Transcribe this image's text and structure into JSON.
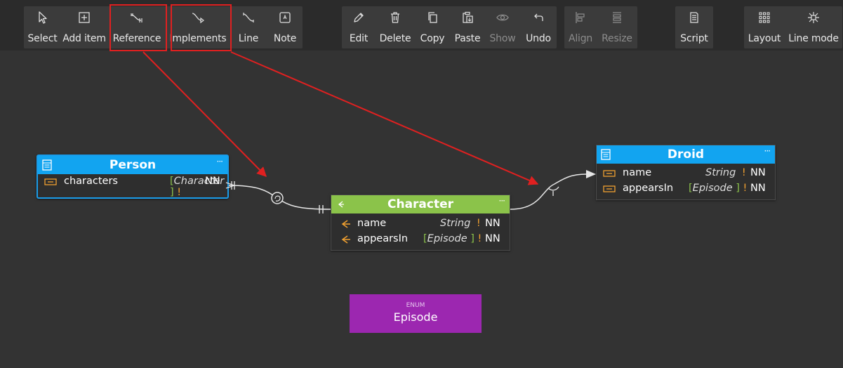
{
  "toolbar": {
    "select": "Select",
    "add_item": "Add item",
    "reference": "Reference",
    "implements": "Implements",
    "line": "Line",
    "note": "Note",
    "edit": "Edit",
    "delete": "Delete",
    "copy": "Copy",
    "paste": "Paste",
    "show": "Show",
    "undo": "Undo",
    "align": "Align",
    "resize": "Resize",
    "script": "Script",
    "layout": "Layout",
    "line_mode": "Line mode"
  },
  "entities": {
    "person": {
      "title": "Person",
      "more": "···",
      "fields": [
        {
          "name": "characters",
          "bracket_open": "[",
          "type": "Character",
          "bracket_close": "]",
          "required": "!",
          "nn": "NN"
        }
      ]
    },
    "character": {
      "title": "Character",
      "more": "···",
      "fields": [
        {
          "name": "name",
          "type": "String",
          "required": "!",
          "nn": "NN"
        },
        {
          "name": "appearsIn",
          "bracket_open": "[",
          "type": "Episode",
          "bracket_close": "]",
          "required": "!",
          "nn": "NN"
        }
      ]
    },
    "droid": {
      "title": "Droid",
      "more": "···",
      "fields": [
        {
          "name": "name",
          "type": "String",
          "required": "!",
          "nn": "NN"
        },
        {
          "name": "appearsIn",
          "bracket_open": "[",
          "type": "Episode",
          "bracket_close": "]",
          "required": "!",
          "nn": "NN"
        }
      ]
    }
  },
  "enum": {
    "type_label": "ENUM",
    "name": "Episode"
  },
  "colors": {
    "canvas": "#333333",
    "toolbar": "#2b2b2b",
    "object_header": "#12a4f0",
    "interface_header": "#8bc34a",
    "enum": "#9c27b0",
    "highlight": "#e02020",
    "field_icon": "#f0a030"
  },
  "icons": [
    "cursor-icon",
    "add-box-icon",
    "reference-line-icon",
    "implements-line-icon",
    "line-icon",
    "note-icon",
    "pencil-icon",
    "trash-icon",
    "copy-icon",
    "paste-icon",
    "eye-icon",
    "undo-icon",
    "align-icon",
    "resize-icon",
    "script-icon",
    "layout-grid-icon",
    "line-mode-icon"
  ]
}
